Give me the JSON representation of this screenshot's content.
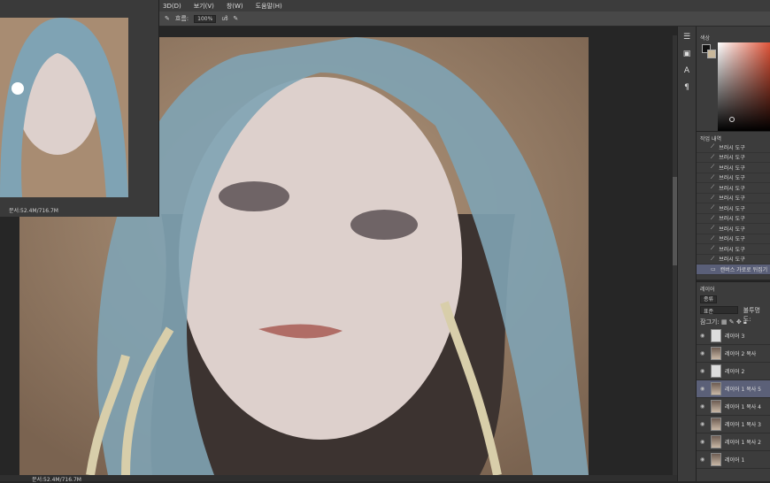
{
  "menu": [
    "3D(D)",
    "보기(V)",
    "창(W)",
    "도움말(H)"
  ],
  "options": {
    "flow_label": "흐름:",
    "flow_value": "100%"
  },
  "navigator": {
    "status": "문서:52.4M/716.7M"
  },
  "status": {
    "doc": "문서:52.4M/716.7M"
  },
  "color_panel": {
    "tab": "색상"
  },
  "history": {
    "title": "작업 내역",
    "items": [
      "브러시 도구",
      "브러시 도구",
      "브러시 도구",
      "브러시 도구",
      "브러시 도구",
      "브러시 도구",
      "브러시 도구",
      "브러시 도구",
      "브러시 도구",
      "브러시 도구",
      "브러시 도구",
      "브러시 도구"
    ],
    "last": "캔버스 가로로 뒤집기"
  },
  "layers": {
    "title": "레이어",
    "kind": "종류",
    "blend": "표준",
    "opacity_label": "불투명도:",
    "lock_label": "잠그기:",
    "items": [
      {
        "name": "레이어 3",
        "thumb": "blank"
      },
      {
        "name": "레이어 2 복사",
        "thumb": "paint"
      },
      {
        "name": "레이어 2",
        "thumb": "blank"
      },
      {
        "name": "레이어 1 복사 5",
        "thumb": "paint",
        "selected": true
      },
      {
        "name": "레이어 1 복사 4",
        "thumb": "paint"
      },
      {
        "name": "레이어 1 복사 3",
        "thumb": "paint"
      },
      {
        "name": "레이어 1 복사 2",
        "thumb": "paint"
      },
      {
        "name": "레이어 1",
        "thumb": "paint"
      }
    ]
  },
  "colors": {
    "accent": "#5b6078",
    "bg": "#262626"
  }
}
